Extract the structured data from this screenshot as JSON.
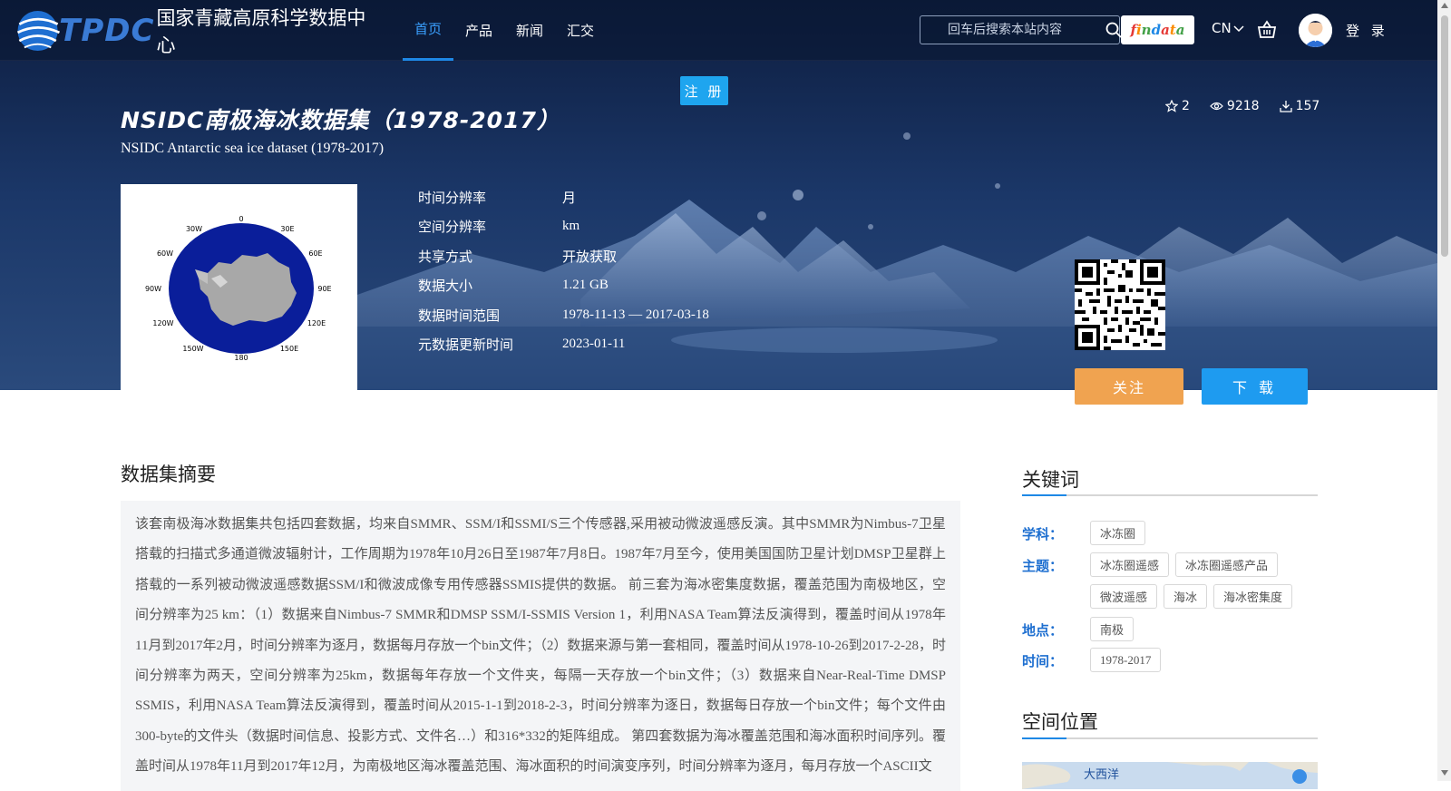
{
  "header": {
    "logo_abbr": "TPDC",
    "logo_name": "国家青藏高原科学数据中心",
    "nav": [
      {
        "label": "首页",
        "active": true
      },
      {
        "label": "产品",
        "active": false
      },
      {
        "label": "新闻",
        "active": false
      },
      {
        "label": "汇交",
        "active": false
      }
    ],
    "search_placeholder": "回车后搜索本站内容",
    "findata": [
      "f",
      "i",
      "n",
      "d",
      "a",
      "t",
      "a"
    ],
    "lang": "CN",
    "login": "登 录"
  },
  "register_label": "注 册",
  "dataset": {
    "title_cn": "NSIDC南极海冰数据集（1978-2017）",
    "title_en": "NSIDC Antarctic sea ice dataset (1978-2017)",
    "stars": "2",
    "views": "9218",
    "downloads": "157",
    "meta": [
      {
        "label": "时间分辨率",
        "value": "月"
      },
      {
        "label": "空间分辨率",
        "value": "km"
      },
      {
        "label": "共享方式",
        "value": "开放获取"
      },
      {
        "label": "数据大小",
        "value": "1.21 GB"
      },
      {
        "label": "数据时间范围",
        "value": "1978-11-13 — 2017-03-18"
      },
      {
        "label": "元数据更新时间",
        "value": "2023-01-11"
      }
    ],
    "thumbnail_labels": [
      "0",
      "30E",
      "60E",
      "90E",
      "120E",
      "150E",
      "180",
      "150W",
      "120W",
      "90W",
      "60W",
      "30W"
    ],
    "follow_label": "关注",
    "download_label": "下 载"
  },
  "abstract": {
    "title": "数据集摘要",
    "text": "该套南极海冰数据集共包括四套数据，均来自SMMR、SSM/I和SSMI/S三个传感器,采用被动微波遥感反演。其中SMMR为Nimbus-7卫星搭载的扫描式多通道微波辐射计，工作周期为1978年10月26日至1987年7月8日。1987年7月至今，使用美国国防卫星计划DMSP卫星群上搭载的一系列被动微波遥感数据SSM/I和微波成像专用传感器SSMIS提供的数据。 前三套为海冰密集度数据，覆盖范围为南极地区，空间分辨率为25 km：（1）数据来自Nimbus-7 SMMR和DMSP SSM/I-SSMIS Version 1，利用NASA Team算法反演得到，覆盖时间从1978年11月到2017年2月，时间分辨率为逐月，数据每月存放一个bin文件；（2）数据来源与第一套相同，覆盖时间从1978-10-26到2017-2-28，时间分辨率为两天，空间分辨率为25km，数据每年存放一个文件夹，每隔一天存放一个bin文件；（3）数据来自Near-Real-Time DMSP SSMIS，利用NASA Team算法反演得到，覆盖时间从2015-1-1到2018-2-3，时间分辨率为逐日，数据每日存放一个bin文件；每个文件由300-byte的文件头（数据时间信息、投影方式、文件名…）和316*332的矩阵组成。 第四套数据为海冰覆盖范围和海冰面积时间序列。覆盖时间从1978年11月到2017年12月，为南极地区海冰覆盖范围、海冰面积的时间演变序列，时间分辨率为逐月，每月存放一个ASCII文"
  },
  "keywords": {
    "title": "关键词",
    "groups": [
      {
        "label": "学科：",
        "tags": [
          "冰冻圈"
        ]
      },
      {
        "label": "主题：",
        "tags": [
          "冰冻圈遥感",
          "冰冻圈遥感产品",
          "微波遥感",
          "海冰",
          "海冰密集度"
        ]
      },
      {
        "label": "地点：",
        "tags": [
          "南极"
        ]
      },
      {
        "label": "时间：",
        "tags": [
          "1978-2017"
        ]
      }
    ]
  },
  "spatial": {
    "title": "空间位置",
    "map_label": "大西洋"
  },
  "colors": {
    "accent": "#1e88e5",
    "follow": "#f0a350",
    "download": "#1e9bf0",
    "register": "#1ea5ef"
  }
}
